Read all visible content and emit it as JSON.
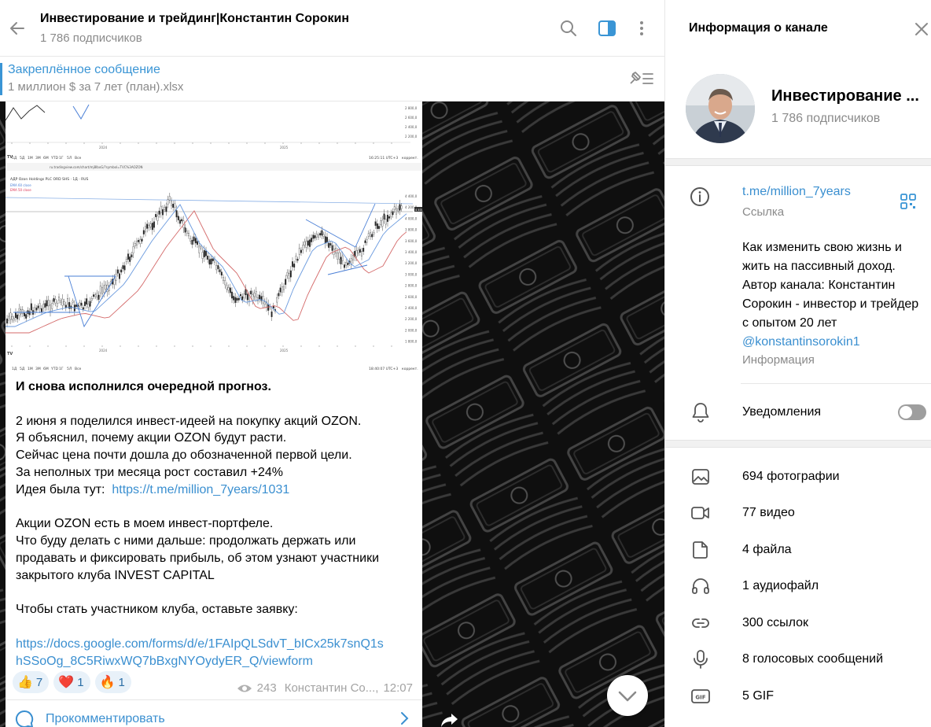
{
  "chat": {
    "title": "Инвестирование и трейдинг|Константин Сорокин",
    "subscribers": "1 786 подписчиков"
  },
  "pinned": {
    "title": "Закреплённое сообщение",
    "text": "1 миллион $ за 7 лет (план).xlsx"
  },
  "post": {
    "heading": "И снова исполнился очередной прогноз.",
    "lines1": [
      "2 июня я поделился инвест-идеей на покупку акций OZON.",
      "Я объяснил, почему акции OZON будут расти.",
      "Сейчас цена почти дошла до обозначенной первой цели.",
      "За неполных три месяца рост составил +24%"
    ],
    "idea_prefix": "Идея была тут:",
    "idea_link": "https://t.me/million_7years/1031",
    "lines2": [
      "Акции OZON есть в моем инвест-портфеле.",
      "Что буду делать с ними дальше: продолжать держать или",
      "продавать и фиксировать прибыль, об этом узнают участники",
      "закрытого клуба INVEST CAPITAL"
    ],
    "cta": "Чтобы стать участником клуба, оставьте заявку:",
    "form_link_1": "https://docs.google.com/forms/d/e/1FAIpQLSdvT_bICx25k7snQ1s",
    "form_link_2": "hSSoOg_8C5RiwxWQ7bBxgNYOydyER_Q/viewform",
    "reactions": [
      {
        "emoji": "👍",
        "count": "7"
      },
      {
        "emoji": "❤️",
        "count": "1"
      },
      {
        "emoji": "🔥",
        "count": "1"
      }
    ],
    "views": "243",
    "author": "Константин Со...,",
    "time": "12:07",
    "comment_label": "Прокомментировать"
  },
  "chart_image": {
    "top_label": "АДР Ozon Holdings PLC ORD SHS · 1Д · RUS",
    "url": "ru.tradingview.com/chart/mj8lbxG/?symbol=TVC%3AOZON",
    "timeframes": [
      "1Д",
      "5Д",
      "1М",
      "3М",
      "6М",
      "YTD",
      "1Г",
      "5Л",
      "Все"
    ],
    "year_labels": [
      "2024",
      "2025"
    ],
    "price_ticks": [
      "4 400,0",
      "4 200,0",
      "4 000,0",
      "3 800,0",
      "3 600,0",
      "3 400,0",
      "3 200,0",
      "3 000,0",
      "2 800,0",
      "2 600,0",
      "2 400,0",
      "2 200,0",
      "2 000,0",
      "1 800,0"
    ],
    "time_top": "16:25:11 UTC+3",
    "time_bottom": "18:40:07 UTC+3",
    "corr_label": "коррект."
  },
  "info": {
    "title": "Информация о канале",
    "channel_name": "Инвестирование ...",
    "subscribers": "1 786 подписчиков",
    "link": "t.me/million_7years",
    "link_label": "Ссылка",
    "about": "Как изменить свою жизнь и жить на пассивный доход. Автор канала: Константин Сорокин - инвестор и трейдер с опытом 20 лет",
    "about_handle": "@konstantinsorokin1",
    "about_label": "Информация",
    "notifications": "Уведомления",
    "media": {
      "photos": "694 фотографии",
      "videos": "77 видео",
      "files": "4 файла",
      "audio": "1 аудиофайл",
      "links": "300 ссылок",
      "voice": "8 голосовых сообщений",
      "gif": "5 GIF"
    }
  },
  "colors": {
    "accent": "#3a95d5",
    "link": "#3a8fd0",
    "muted": "#8a8a8a",
    "wallpaper": "#1c1c1c"
  }
}
